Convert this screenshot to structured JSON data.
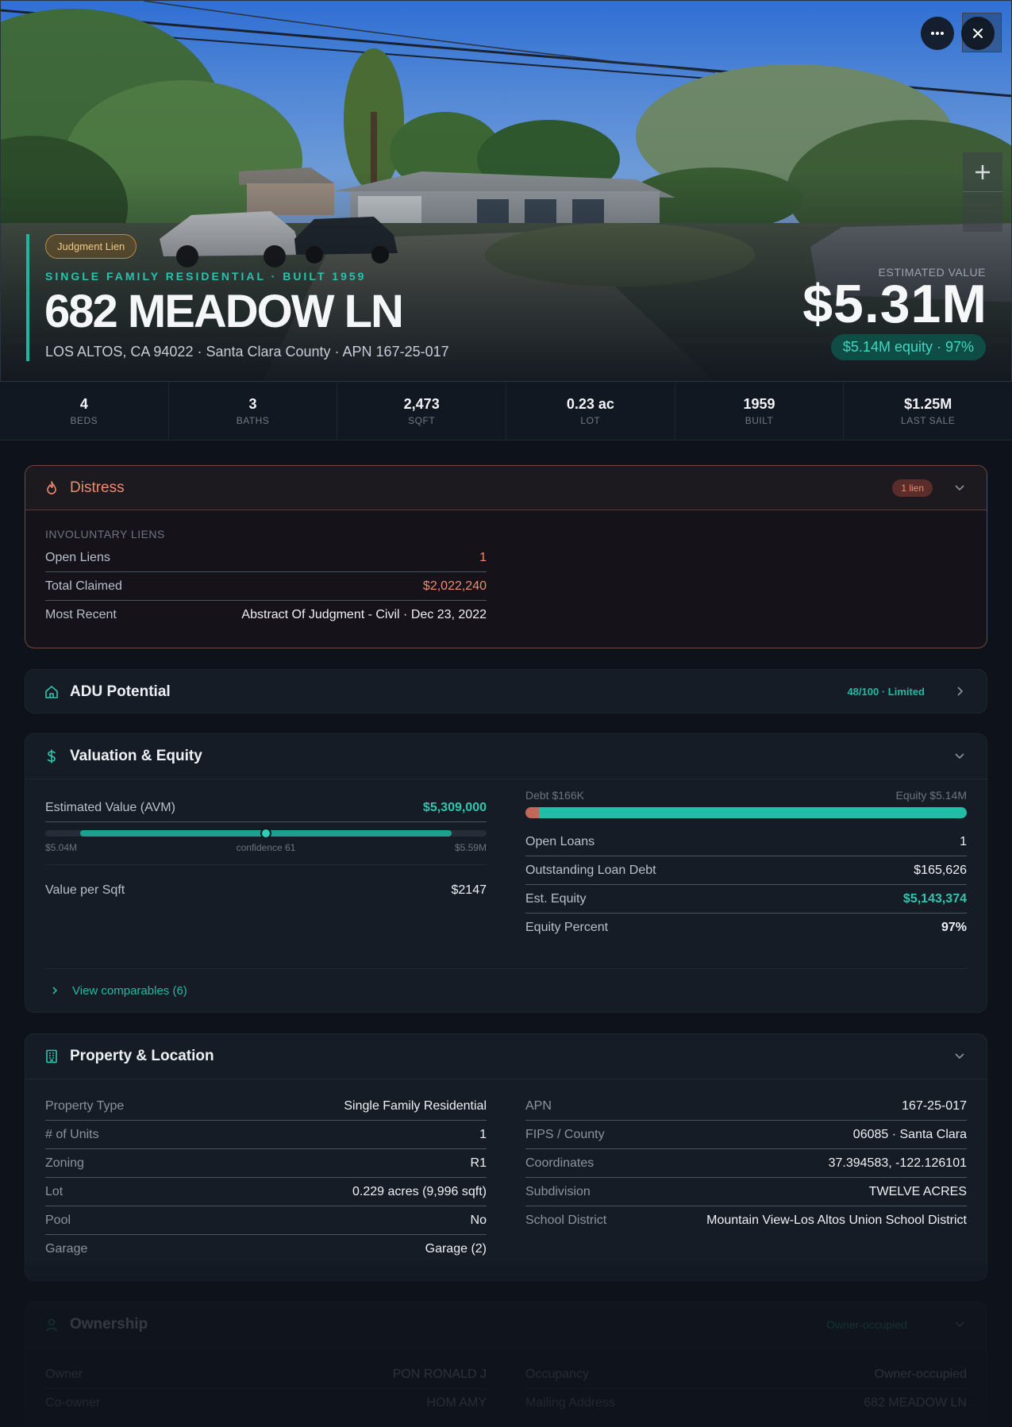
{
  "hero": {
    "badge": "Judgment Lien",
    "eyebrow": "SINGLE FAMILY RESIDENTIAL · BUILT 1959",
    "address": "682 MEADOW LN",
    "subline": "LOS ALTOS, CA 94022 · Santa Clara County · APN 167-25-017",
    "estimated_label": "ESTIMATED VALUE",
    "estimated_value": "$5.31M",
    "equity_pill": "$5.14M equity · 97%"
  },
  "stats": [
    {
      "value": "4",
      "label": "BEDS"
    },
    {
      "value": "3",
      "label": "BATHS"
    },
    {
      "value": "2,473",
      "label": "SQFT"
    },
    {
      "value": "0.23 ac",
      "label": "LOT"
    },
    {
      "value": "1959",
      "label": "BUILT"
    },
    {
      "value": "$1.25M",
      "label": "LAST SALE"
    }
  ],
  "distress": {
    "title": "Distress",
    "badge": "1 lien",
    "section": "INVOLUNTARY LIENS",
    "rows": [
      {
        "k": "Open Liens",
        "v": "1"
      },
      {
        "k": "Total Claimed",
        "v": "$2,022,240"
      },
      {
        "k": "Most Recent",
        "v": "Abstract Of Judgment - Civil · Dec 23, 2022"
      }
    ]
  },
  "adu": {
    "title": "ADU Potential",
    "score": "48/100 · Limited"
  },
  "valuation": {
    "title": "Valuation & Equity",
    "avm_label": "Estimated Value (AVM)",
    "avm_value": "$5,309,000",
    "range_low": "$5.04M",
    "range_mid": "confidence 61",
    "range_high": "$5.59M",
    "range_fill_start": 0.08,
    "range_fill_end": 0.92,
    "range_point": 0.5,
    "vps_label": "Value per Sqft",
    "vps_value": "$2147",
    "debt_label": "Debt $166K",
    "equity_label": "Equity $5.14M",
    "debt_fraction": 0.03,
    "rows": [
      {
        "k": "Open Loans",
        "v": "1"
      },
      {
        "k": "Outstanding Loan Debt",
        "v": "$165,626"
      },
      {
        "k": "Est. Equity",
        "v": "$5,143,374"
      },
      {
        "k": "Equity Percent",
        "v": "97%"
      }
    ],
    "view_comps": "View comparables (6)"
  },
  "property": {
    "title": "Property & Location",
    "left": [
      {
        "k": "Property Type",
        "v": "Single Family Residential"
      },
      {
        "k": "# of Units",
        "v": "1"
      },
      {
        "k": "Zoning",
        "v": "R1"
      },
      {
        "k": "Lot",
        "v": "0.229 acres (9,996 sqft)"
      },
      {
        "k": "Pool",
        "v": "No"
      },
      {
        "k": "Garage",
        "v": "Garage (2)"
      }
    ],
    "right": [
      {
        "k": "APN",
        "v": "167-25-017"
      },
      {
        "k": "FIPS / County",
        "v": "06085 · Santa Clara"
      },
      {
        "k": "Coordinates",
        "v": "37.394583, -122.126101"
      },
      {
        "k": "Subdivision",
        "v": "TWELVE ACRES"
      },
      {
        "k": "School District",
        "v": "Mountain View-Los Altos Union School District"
      }
    ]
  },
  "ownership": {
    "title": "Ownership",
    "badge": "Owner-occupied",
    "left": [
      {
        "k": "Owner",
        "v": "PON RONALD J"
      },
      {
        "k": "Co-owner",
        "v": "HOM AMY"
      }
    ],
    "right": [
      {
        "k": "Occupancy",
        "v": "Owner-occupied"
      },
      {
        "k": "Mailing Address",
        "v": "682 MEADOW LN"
      }
    ]
  },
  "colors": {
    "accent": "#22bda7",
    "distress": "#ef8a6d",
    "lien_badge": "#f1c887"
  },
  "icons": [
    "more-icon",
    "close-icon",
    "plus-icon",
    "flame-icon",
    "home-icon",
    "dollar-icon",
    "building-icon",
    "user-icon",
    "chevron-down-icon",
    "chevron-right-icon"
  ]
}
